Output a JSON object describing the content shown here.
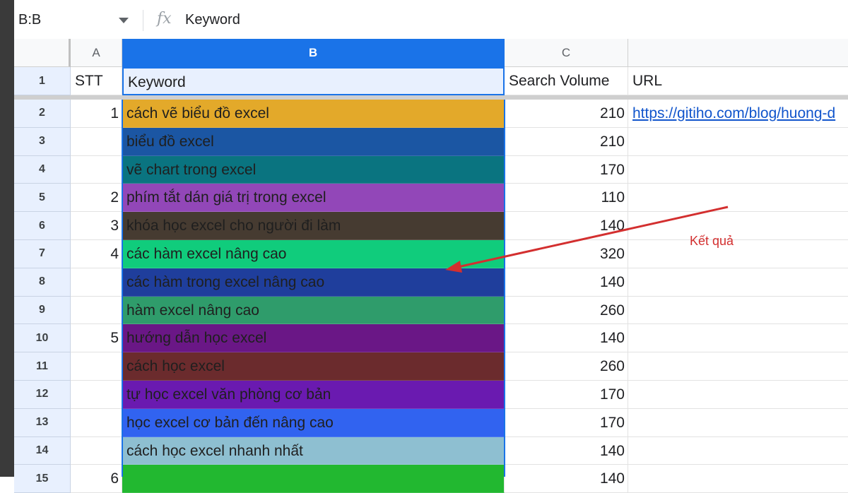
{
  "name_box": "B:B",
  "formula": {
    "icon": "fx",
    "value": "Keyword"
  },
  "columns": [
    {
      "id": "A",
      "label": "A"
    },
    {
      "id": "B",
      "label": "B"
    },
    {
      "id": "C",
      "label": "C"
    },
    {
      "id": "D",
      "label": ""
    }
  ],
  "header_row": {
    "num": "1",
    "a": "STT",
    "b": "Keyword",
    "c": "Search Volume",
    "d": "URL"
  },
  "rows": [
    {
      "num": "2",
      "a": "1",
      "b": "cách vẽ biểu đồ excel",
      "c": "210",
      "d": "https://gitiho.com/blog/huong-d",
      "fill": "#e3a92a"
    },
    {
      "num": "3",
      "a": "",
      "b": "biểu đồ excel",
      "c": "210",
      "d": "",
      "fill": "#1b56a3"
    },
    {
      "num": "4",
      "a": "",
      "b": "vẽ chart trong excel",
      "c": "170",
      "d": "",
      "fill": "#0a7480"
    },
    {
      "num": "5",
      "a": "2",
      "b": "phím tắt dán giá trị trong excel",
      "c": "110",
      "d": "",
      "fill": "#9247b8"
    },
    {
      "num": "6",
      "a": "3",
      "b": "khóa học excel cho người đi làm",
      "c": "140",
      "d": "",
      "fill": "#463b31"
    },
    {
      "num": "7",
      "a": "4",
      "b": "các hàm excel nâng cao",
      "c": "320",
      "d": "",
      "fill": "#10cc7c"
    },
    {
      "num": "8",
      "a": "",
      "b": "các hàm trong excel nâng cao",
      "c": "140",
      "d": "",
      "fill": "#1f3e9c"
    },
    {
      "num": "9",
      "a": "",
      "b": "hàm excel nâng cao",
      "c": "260",
      "d": "",
      "fill": "#2f9c6b"
    },
    {
      "num": "10",
      "a": "5",
      "b": "hướng dẫn học excel",
      "c": "140",
      "d": "",
      "fill": "#6a1786"
    },
    {
      "num": "11",
      "a": "",
      "b": "cách học excel",
      "c": "260",
      "d": "",
      "fill": "#6b2b2d"
    },
    {
      "num": "12",
      "a": "",
      "b": "tự học excel văn phòng cơ bản",
      "c": "170",
      "d": "",
      "fill": "#6a1ab0"
    },
    {
      "num": "13",
      "a": "",
      "b": "học excel cơ bản đến nâng cao",
      "c": "170",
      "d": "",
      "fill": "#3163f0"
    },
    {
      "num": "14",
      "a": "",
      "b": "cách học excel nhanh nhất",
      "c": "140",
      "d": "",
      "fill": "#8ebfd1"
    },
    {
      "num": "15",
      "a": "6",
      "b": "",
      "c": "140",
      "d": "",
      "fill": "#22b830"
    }
  ],
  "annotation": {
    "text": "Kết quả",
    "color": "#d32f2f"
  }
}
